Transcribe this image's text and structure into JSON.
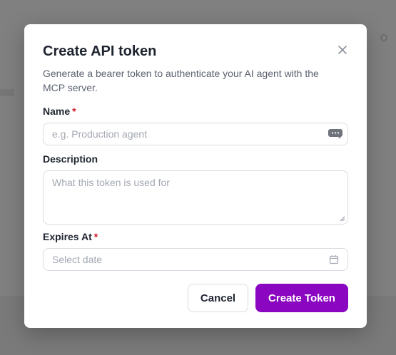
{
  "dialog": {
    "title": "Create API token",
    "subtitle": "Generate a bearer token to authenticate your AI agent with the MCP server.",
    "close_icon": "close-icon"
  },
  "form": {
    "name": {
      "label": "Name",
      "required_marker": "*",
      "value": "",
      "placeholder": "e.g. Production agent",
      "trailing_icon": "chat-bubble-icon"
    },
    "description": {
      "label": "Description",
      "value": "",
      "placeholder": "What this token is used for"
    },
    "expires_at": {
      "label": "Expires At",
      "required_marker": "*",
      "value": "",
      "placeholder": "Select date",
      "trailing_icon": "calendar-icon"
    }
  },
  "actions": {
    "cancel_label": "Cancel",
    "create_label": "Create Token"
  },
  "colors": {
    "primary": "#8a06c0",
    "required": "#d11a2a",
    "overlay": "#808080"
  }
}
